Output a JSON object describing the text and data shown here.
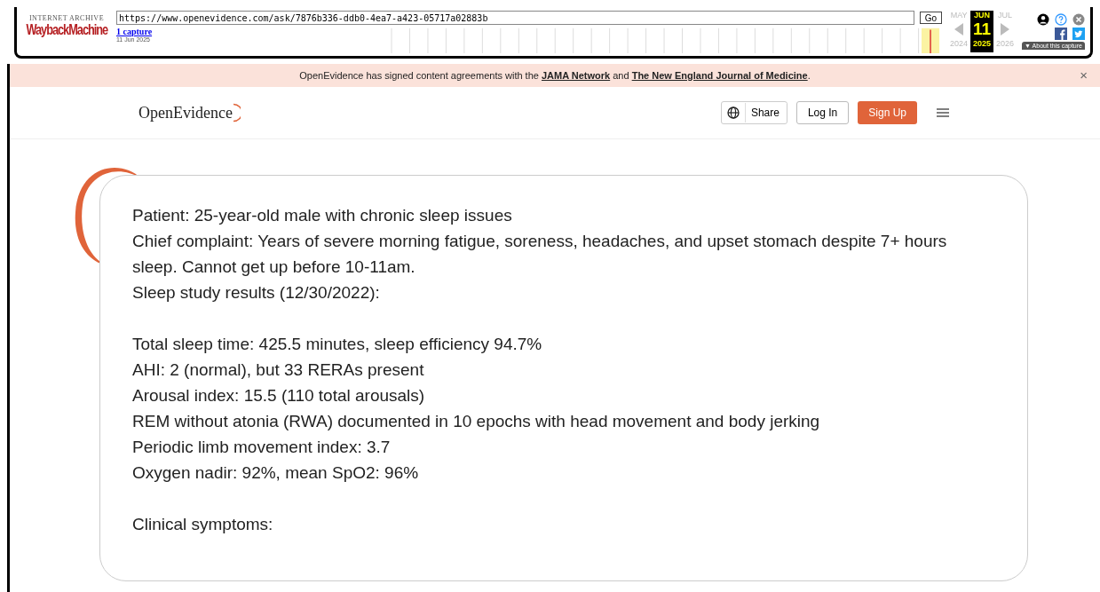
{
  "wayback": {
    "logo_top": "INTERNET ARCHIVE",
    "logo": "WaybackMachine",
    "url": "https://www.openevidence.com/ask/7876b336-ddb0-4ea7-a423-05717a02883b",
    "go": "Go",
    "captures": "1 capture",
    "capture_date": "11 Jun 2025",
    "months": [
      {
        "month": "MAY",
        "year": "2024",
        "selected": false
      },
      {
        "month": "JUN",
        "day": "11",
        "year": "2025",
        "selected": true
      },
      {
        "month": "JUL",
        "year": "2026",
        "selected": false
      }
    ],
    "about": "▼ About this capture"
  },
  "banner": {
    "text": "OpenEvidence has signed content agreements with the **JAMA Network** and **The New England Journal of Medicine**.",
    "close": "×"
  },
  "header": {
    "brand": "OpenEvidence",
    "share": "Share",
    "login": "Log In",
    "signup": "Sign Up"
  },
  "card": {
    "blocks": [
      [
        "Patient: 25-year-old male with chronic sleep issues",
        "Chief complaint: Years of severe morning fatigue, soreness, headaches, and upset stomach despite 7+ hours sleep. Cannot get up before 10-11am.",
        "Sleep study results (12/30/2022):"
      ],
      [
        "Total sleep time: 425.5 minutes, sleep efficiency 94.7%",
        "AHI: 2 (normal), but 33 RERAs present",
        "Arousal index: 15.5 (110 total arousals)",
        "REM without atonia (RWA) documented in 10 epochs with head movement and body jerking",
        "Periodic limb movement index: 3.7",
        "Oxygen nadir: 92%, mean SpO2: 96%"
      ],
      [
        "Clinical symptoms:"
      ]
    ]
  }
}
